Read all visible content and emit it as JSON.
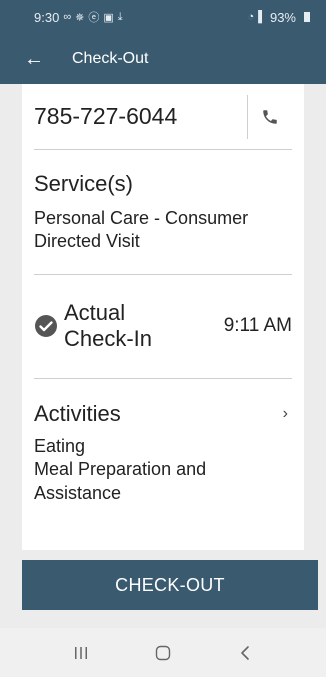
{
  "status_bar": {
    "time": "9:30",
    "notification_icons": [
      "voicemail-icon",
      "pinwheel-icon",
      "circle-e-icon",
      "image-icon",
      "download-icon"
    ],
    "battery_percent": "93%"
  },
  "app_bar": {
    "title": "Check-Out"
  },
  "contact": {
    "phone": "785-727-6044"
  },
  "services": {
    "title": "Service(s)",
    "value": "Personal Care - Consumer Directed Visit"
  },
  "check_in": {
    "label_line1": "Actual",
    "label_line2": "Check-In",
    "time": "9:11 AM"
  },
  "activities": {
    "title": "Activities",
    "items": [
      "Eating",
      "Meal Preparation and Assistance"
    ]
  },
  "actions": {
    "checkout_label": "CHECK-OUT"
  },
  "colors": {
    "primary": "#3a5a70",
    "check": "#555555"
  }
}
